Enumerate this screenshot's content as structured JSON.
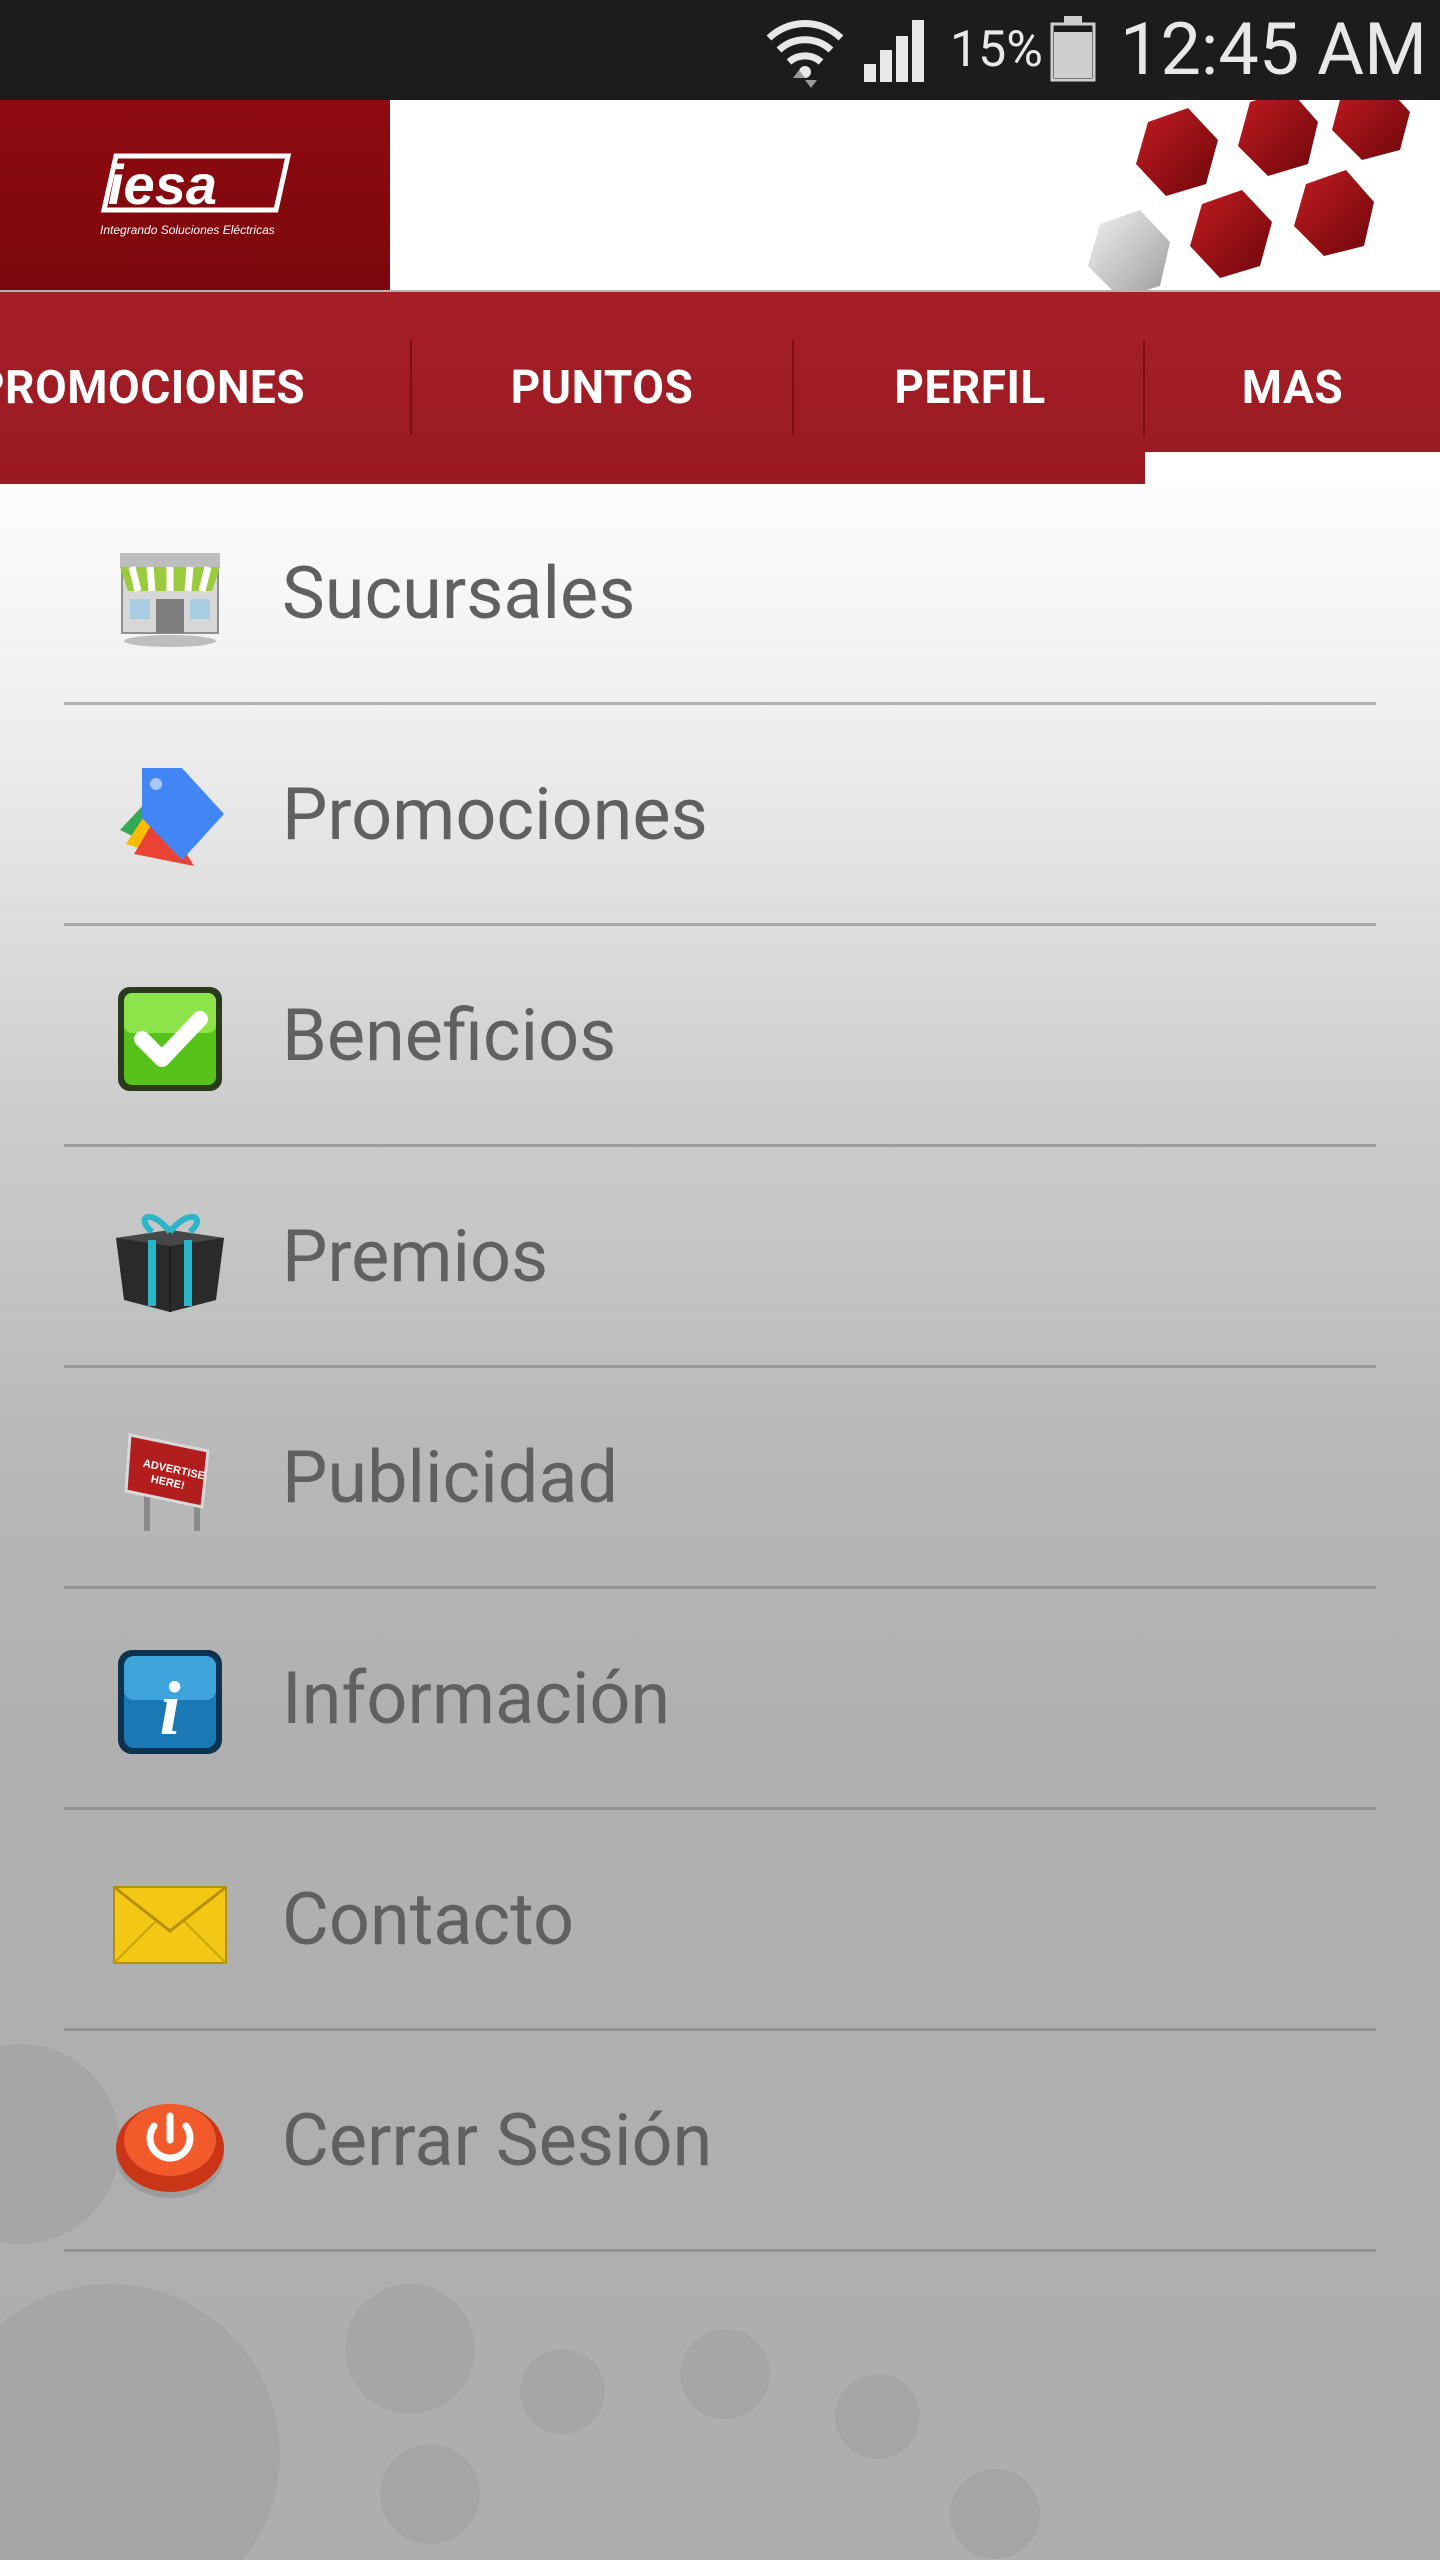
{
  "status_bar": {
    "battery_percent": "15%",
    "time": "12:45 AM",
    "icons": [
      "wifi-icon",
      "signal-icon",
      "battery-icon"
    ]
  },
  "header": {
    "brand": "iesa",
    "tagline": "Integrando Soluciones Eléctricas",
    "colors": {
      "brand_dark": "#8e0b10",
      "tab_bar": "#a61f27"
    }
  },
  "tabs": [
    {
      "label": "PROMOCIONES"
    },
    {
      "label": "PUNTOS"
    },
    {
      "label": "PERFIL"
    },
    {
      "label": "MAS",
      "selected": true
    }
  ],
  "menu": {
    "items": [
      {
        "label": "Sucursales",
        "icon": "store-icon"
      },
      {
        "label": "Promociones",
        "icon": "price-tag-icon"
      },
      {
        "label": "Beneficios",
        "icon": "checkmark-icon"
      },
      {
        "label": "Premios",
        "icon": "gift-icon"
      },
      {
        "label": "Publicidad",
        "icon": "billboard-icon"
      },
      {
        "label": "Información",
        "icon": "info-icon"
      },
      {
        "label": "Contacto",
        "icon": "envelope-icon"
      },
      {
        "label": "Cerrar Sesión",
        "icon": "power-icon"
      }
    ]
  }
}
